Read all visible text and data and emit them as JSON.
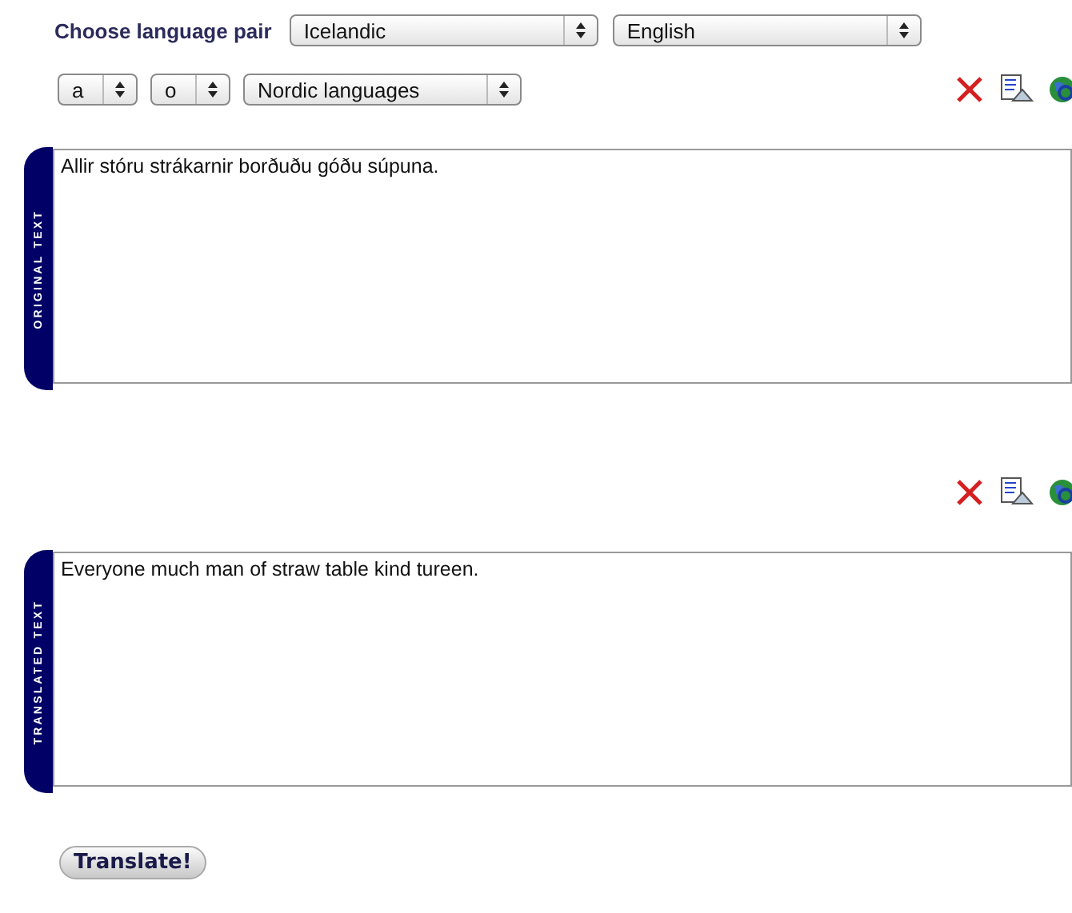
{
  "language_pair": {
    "label": "Choose language pair",
    "source": "Icelandic",
    "target": "English"
  },
  "options": {
    "char_from": "a",
    "char_to": "o",
    "group": "Nordic languages"
  },
  "original": {
    "tab_label": "ORIGINAL TEXT",
    "value": "Allir stóru strákarnir borðuðu góðu súpuna."
  },
  "translated": {
    "tab_label": "TRANSLATED TEXT",
    "value": "Everyone much man of straw table kind tureen."
  },
  "button": "Translate!"
}
